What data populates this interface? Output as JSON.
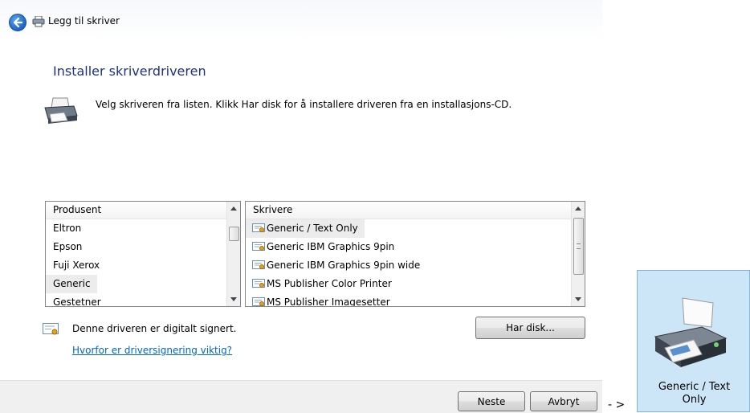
{
  "window": {
    "title": "Legg til skriver",
    "heading": "Installer skriverdriveren",
    "instruction": "Velg skriveren fra listen. Klikk Har disk for å installere driveren fra en installasjons-CD."
  },
  "manufacturers": {
    "header": "Produsent",
    "items": [
      "Eltron",
      "Epson",
      "Fuji Xerox",
      "Generic",
      "Gestetner"
    ],
    "selected": "Generic"
  },
  "printers": {
    "header": "Skrivere",
    "items": [
      "Generic / Text Only",
      "Generic IBM Graphics 9pin",
      "Generic IBM Graphics 9pin wide",
      "MS Publisher Color Printer",
      "MS Publisher Imagesetter"
    ],
    "selected": "Generic / Text Only"
  },
  "signature": {
    "text": "Denne driveren er digitalt signert.",
    "link": "Hvorfor er driversignering viktig?"
  },
  "buttons": {
    "have_disk": "Har disk...",
    "next": "Neste",
    "cancel": "Avbryt"
  },
  "annotation": {
    "arrow": "- >"
  },
  "result_tile": {
    "label_line1": "Generic / Text",
    "label_line2": "Only"
  },
  "icons": [
    "back-arrow-icon",
    "printer-icon",
    "certificate-icon"
  ],
  "colors": {
    "heading": "#1e3287",
    "link": "#0066cc",
    "tile_bg": "#cde6f7",
    "tile_border": "#7eb4ea"
  }
}
